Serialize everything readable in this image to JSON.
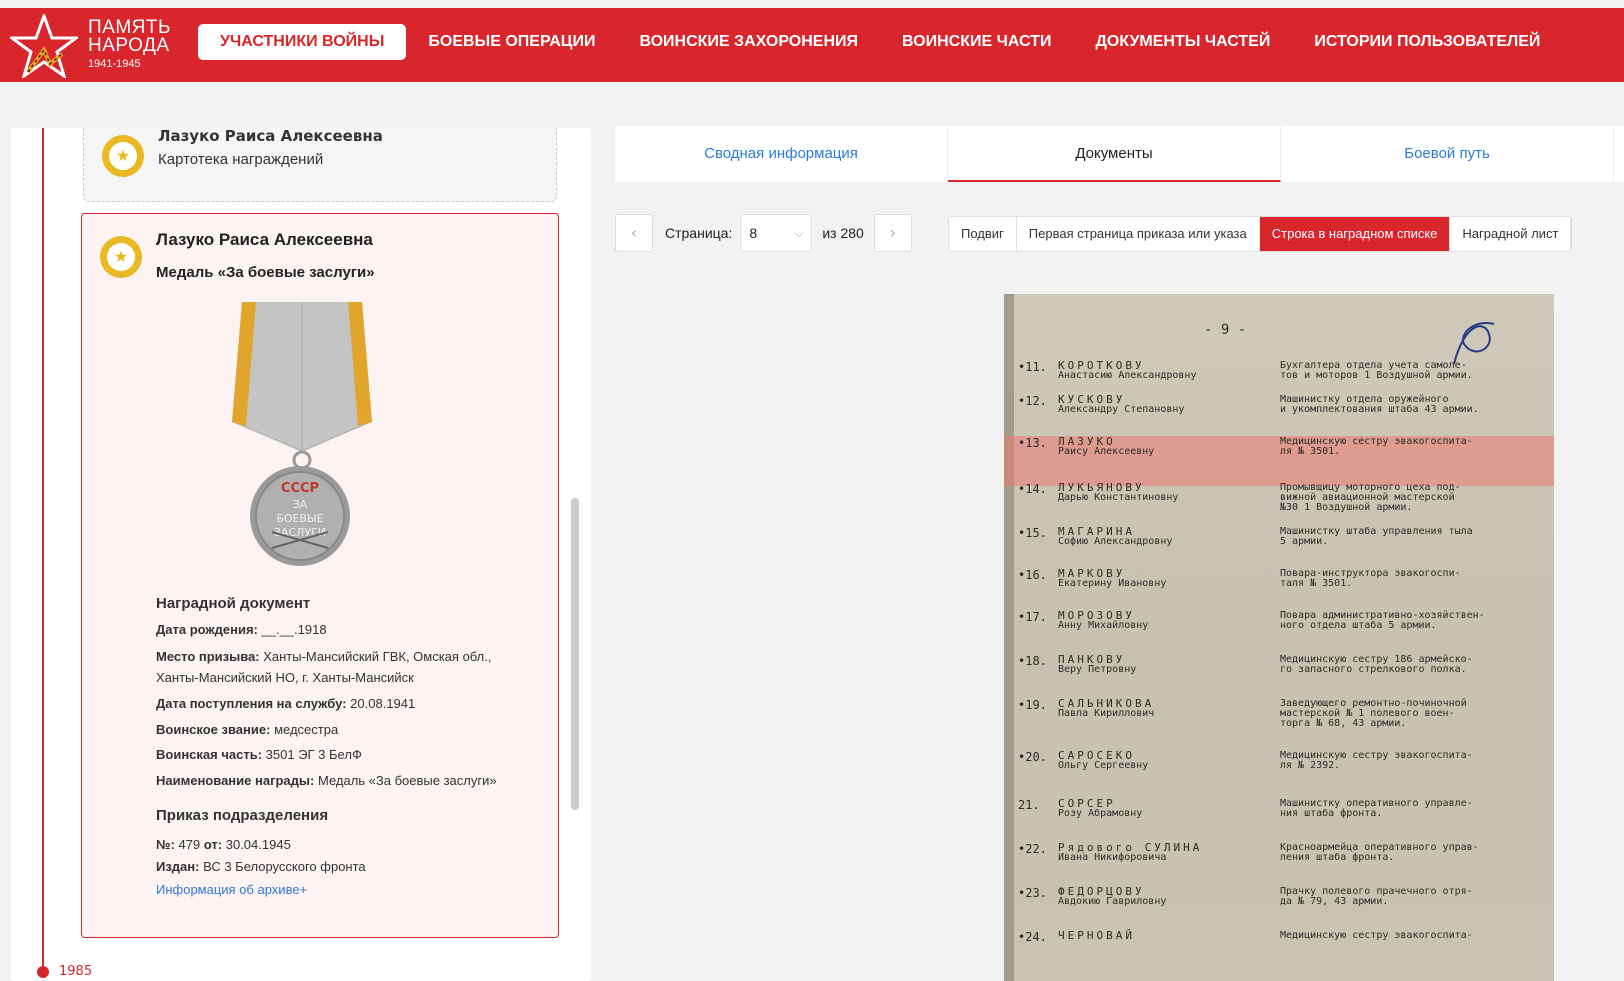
{
  "header": {
    "logo": {
      "line1": "ПАМЯТЬ",
      "line2": "НАРОДА",
      "years": "1941-1945"
    },
    "nav": [
      {
        "label": "УЧАСТНИКИ ВОЙНЫ",
        "active": true
      },
      {
        "label": "БОЕВЫЕ ОПЕРАЦИИ"
      },
      {
        "label": "ВОИНСКИЕ ЗАХОРОНЕНИЯ"
      },
      {
        "label": "ВОИНСКИЕ ЧАСТИ"
      },
      {
        "label": "ДОКУМЕНТЫ ЧАСТЕЙ"
      },
      {
        "label": "ИСТОРИИ ПОЛЬЗОВАТЕЛЕЙ"
      }
    ]
  },
  "left": {
    "card_top": {
      "name": "Лазуко Раиса Алексеевна",
      "subtitle": "Картотека награждений"
    },
    "card_main": {
      "name": "Лазуко Раиса Алексеевна",
      "award": "Медаль «За боевые заслуги»",
      "medal_text": [
        "СССР",
        "ЗА",
        "БОЕВЫЕ",
        "ЗАСЛУГИ"
      ],
      "doc_title": "Наградной документ",
      "fields": [
        {
          "label": "Дата рождения:",
          "value": "__.__.1918"
        },
        {
          "label": "Место призыва:",
          "value": "Ханты-Мансийский ГВК, Омская обл., Ханты-Мансийский НО, г. Ханты-Мансийск"
        },
        {
          "label": "Дата поступления на службу:",
          "value": "20.08.1941"
        },
        {
          "label": "Воинское звание:",
          "value": "медсестра"
        },
        {
          "label": "Воинская часть:",
          "value": "3501 ЭГ 3 БелФ"
        },
        {
          "label": "Наименование награды:",
          "value": "Медаль «За боевые заслуги»"
        }
      ],
      "order_title": "Приказ подразделения",
      "order_no_label": "№:",
      "order_no": "479",
      "order_from_label": "от:",
      "order_date": "30.04.1945",
      "issued_label": "Издан:",
      "issued": "ВС 3 Белорусского фронта",
      "archive_link": "Информация об архиве+"
    },
    "year": "1985"
  },
  "tabs": [
    {
      "label": "Сводная информация"
    },
    {
      "label": "Документы",
      "active": true
    },
    {
      "label": "Боевой путь"
    }
  ],
  "pager": {
    "label": "Страница:",
    "page": "8",
    "of_text": "из 280",
    "prev_icon": "chevron-left-icon",
    "next_icon": "chevron-right-icon"
  },
  "doc_types": [
    {
      "label": "Подвиг"
    },
    {
      "label": "Первая страница приказа или указа"
    },
    {
      "label": "Строка в наградном списке",
      "active": true
    },
    {
      "label": "Наградной лист"
    }
  ],
  "document": {
    "page_mark": "- 9 -",
    "rows": [
      {
        "num": "•11.",
        "n1": "КОРОТКОВУ",
        "n2": "Анастасию Александровну",
        "d": [
          "Бухгалтера отдела учета самоле-",
          "тов и моторов 1 Воздушной армии."
        ]
      },
      {
        "num": "•12.",
        "n1": "КУСКОВУ",
        "n2": "Александру Степановну",
        "d": [
          "Машинистку отдела оружейного",
          "и укомплектования штаба 43 армии."
        ]
      },
      {
        "num": "•13.",
        "n1": "ЛАЗУКО",
        "n2": "Раису Алексеевну",
        "d": [
          "Медицинскую сестру эвакогоспита-",
          "ля № 3501."
        ]
      },
      {
        "num": "•14.",
        "n1": "ЛУКЬЯНОВУ",
        "n2": "Дарью Константиновну",
        "d": [
          "Промывщицу моторного цеха под-",
          "вижной авиационной мастерской",
          "№30 1 Воздушной армии."
        ]
      },
      {
        "num": "•15.",
        "n1": "МАГАРИНА",
        "n2": "Софию Александровну",
        "d": [
          "Машинистку штаба управления тыла",
          "5 армии."
        ]
      },
      {
        "num": "•16.",
        "n1": "МАРКОВУ",
        "n2": "Екатерину Ивановну",
        "d": [
          "Повара-инструктора эвакогоспи-",
          "таля № 3501."
        ]
      },
      {
        "num": "•17.",
        "n1": "МОРОЗОВУ",
        "n2": "Анну Михайловну",
        "d": [
          "Повара административно-хозяйствен-",
          "ного отдела штаба 5 армии."
        ]
      },
      {
        "num": "•18.",
        "n1": "ПАНКОВУ",
        "n2": "Веру Петровну",
        "d": [
          "Медицинскую сестру 186 армейско-",
          "го запасного стрелкового полка."
        ]
      },
      {
        "num": "•19.",
        "n1": "САЛЬНИКОВА",
        "n2": "Павла Кириллович",
        "d": [
          "Заведующего ремонтно-починочной",
          "мастерской № 1 полевого воен-",
          "торга № 68, 43 армии."
        ]
      },
      {
        "num": "•20.",
        "n1": "САРОСЕКО",
        "n2": "Ольгу Сергеевну",
        "d": [
          "Медицинскую сестру эвакогоспита-",
          "ля № 2392."
        ]
      },
      {
        "num": "21.",
        "n1": "СОРСЕР",
        "n2": "Розу Абрамовну",
        "d": [
          "Машинистку оперативного управле-",
          "ния штаба фронта."
        ]
      },
      {
        "num": "•22.",
        "n1": "Рядового СУЛИНА",
        "n2": "Ивана Никифоровича",
        "d": [
          "Красноармейца оперативного управ-",
          "ления штаба фронта."
        ]
      },
      {
        "num": "•23.",
        "n1": "ФЕДОРЦОВУ",
        "n2": "Авдокию Гавриловну",
        "d": [
          "Прачку полевого прачечного отря-",
          "да № 79, 43 армии."
        ]
      },
      {
        "num": "•24.",
        "n1": "ЧЕРНОВАЙ",
        "n2": "",
        "d": [
          "Медицинскую сестру эвакогоспита-"
        ]
      }
    ]
  },
  "colors": {
    "brand": "#d8262c",
    "link": "#2d7bd6",
    "gold": "#e8b923"
  }
}
